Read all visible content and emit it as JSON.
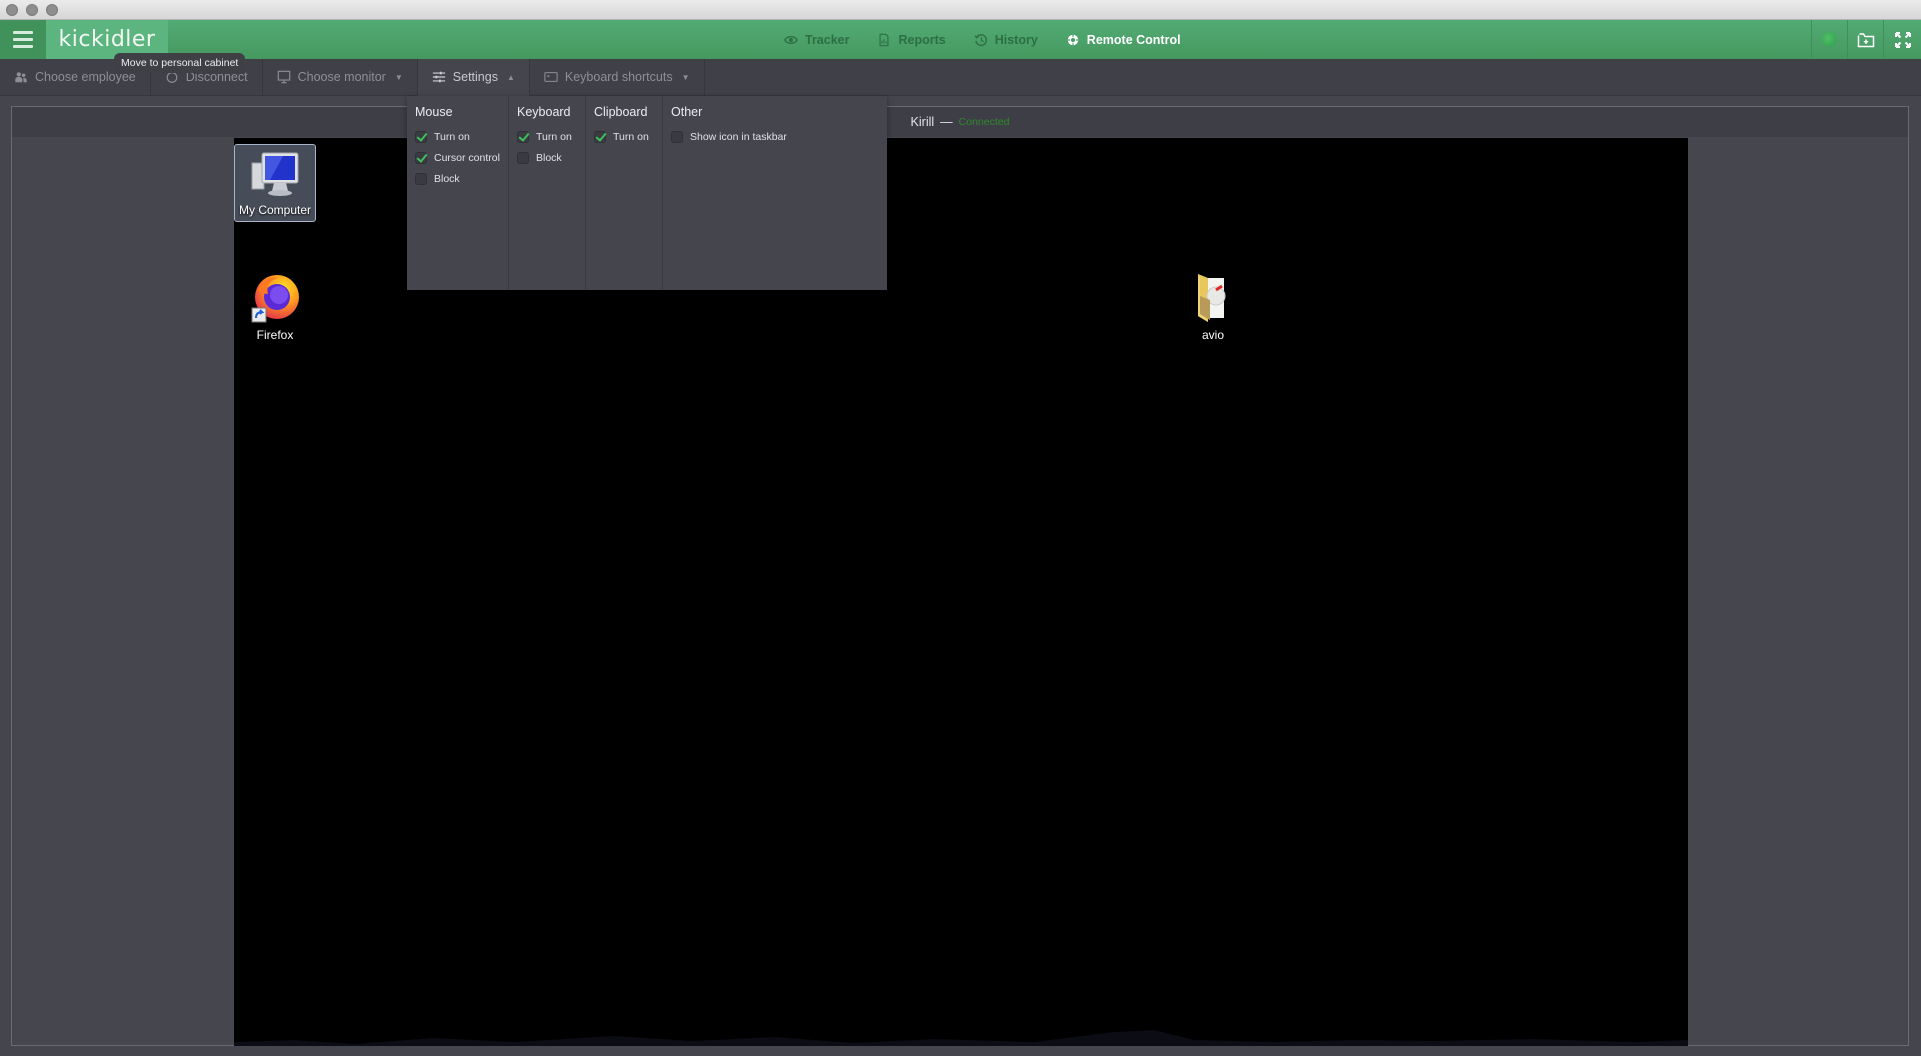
{
  "header": {
    "logo": "kickidler",
    "nav": [
      {
        "label": "Tracker",
        "icon": "eye-icon",
        "active": false
      },
      {
        "label": "Reports",
        "icon": "document-icon",
        "active": false
      },
      {
        "label": "History",
        "icon": "history-icon",
        "active": false
      },
      {
        "label": "Remote Control",
        "icon": "remote-control-icon",
        "active": true
      }
    ],
    "tooltip": "Move to personal cabinet",
    "colors": {
      "brand_green": "#4fa66d",
      "active_text": "#ffffff",
      "inactive_text": "#2d6e43"
    }
  },
  "toolbar": {
    "choose_employee": "Choose employee",
    "disconnect": "Disconnect",
    "choose_monitor": "Choose monitor",
    "settings": "Settings",
    "keyboard_shortcuts": "Keyboard shortcuts"
  },
  "settings": {
    "columns": [
      {
        "title": "Mouse",
        "options": [
          {
            "label": "Turn on",
            "checked": true
          },
          {
            "label": "Cursor control",
            "checked": true
          },
          {
            "label": "Block",
            "checked": false
          }
        ]
      },
      {
        "title": "Keyboard",
        "options": [
          {
            "label": "Turn on",
            "checked": true
          },
          {
            "label": "Block",
            "checked": false
          }
        ]
      },
      {
        "title": "Clipboard",
        "options": [
          {
            "label": "Turn on",
            "checked": true
          }
        ]
      },
      {
        "title": "Other",
        "options": [
          {
            "label": "Show icon in taskbar",
            "checked": false
          }
        ]
      }
    ]
  },
  "session": {
    "employee": "Kirill",
    "separator": "—",
    "status": "Connected",
    "status_color": "#2e8a2a"
  },
  "desktop": {
    "icons": [
      {
        "label": "My Computer",
        "selected": true
      },
      {
        "label": "Firefox",
        "selected": false
      },
      {
        "label": "avio",
        "selected": false
      }
    ]
  }
}
